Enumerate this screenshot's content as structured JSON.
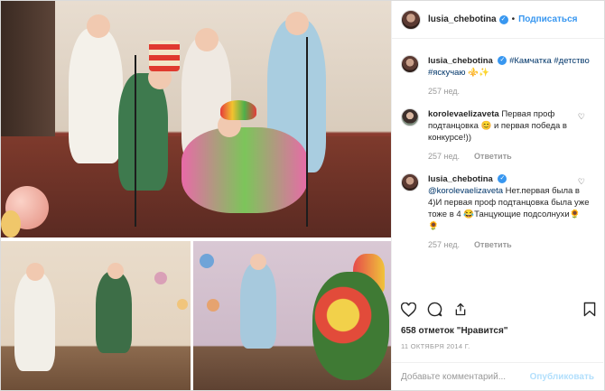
{
  "post": {
    "username": "lusia_chebotina",
    "follow_label": "Подписаться",
    "separator": "•"
  },
  "comments": [
    {
      "username": "lusia_chebotina",
      "text": "#Камчатка #детство #яскучаю ⚜️✨",
      "age": "257 нед.",
      "reply_label": ""
    },
    {
      "username": "korolevaelizaveta",
      "text": "Первая проф подтанцовка 😊 и первая победа в конкурсе!))",
      "age": "257 нед.",
      "reply_label": "Ответить"
    },
    {
      "username": "lusia_chebotina",
      "mention": "@korolevaelizaveta",
      "text": " Нет.первая была в 4)И первая проф подтанцовка была уже тоже в 4 😂Танцующие подсолнухи🌻🌻",
      "age": "257 нед.",
      "reply_label": "Ответить"
    }
  ],
  "likes_text": "658 отметок \"Нравится\"",
  "date_text": "11 ОКТЯБРЯ 2014 Г.",
  "add_comment": {
    "placeholder": "Добавьте комментарий...",
    "publish_label": "Опубликовать"
  },
  "icons": {
    "verified": "verified-badge-icon",
    "like": "heart-icon",
    "comment": "comment-icon",
    "share": "share-icon",
    "save": "bookmark-icon"
  },
  "colors": {
    "accent": "#3897f0",
    "publish_disabled": "#b2dffc",
    "muted": "#999999"
  }
}
